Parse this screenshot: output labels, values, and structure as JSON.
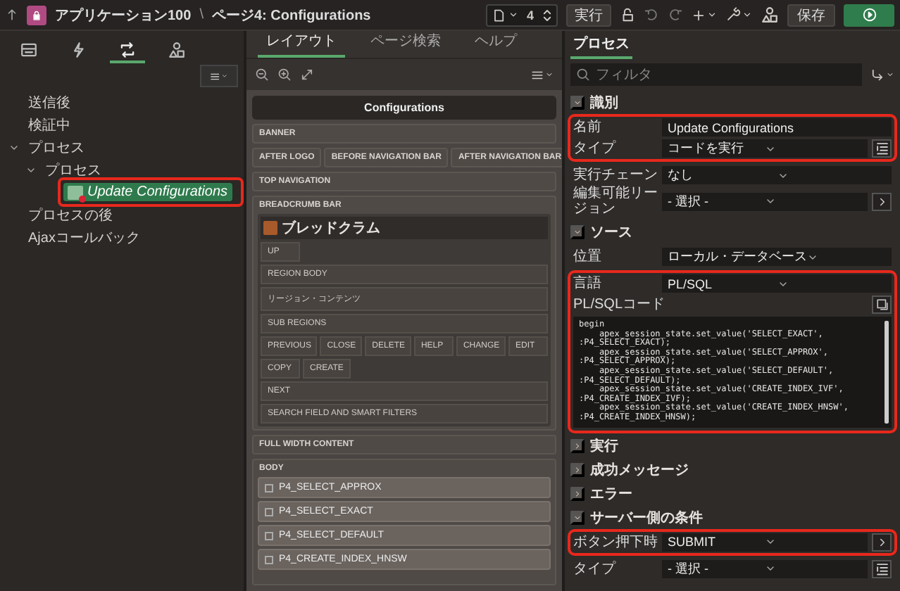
{
  "toolbar": {
    "app": "アプリケーション100",
    "separator": "\\",
    "page": "ページ4: Configurations",
    "page_number": "4",
    "run_page": "実行",
    "save": "保存"
  },
  "left": {
    "tabs": [
      {
        "selected": false
      },
      {
        "selected": false
      },
      {
        "selected": true
      },
      {
        "selected": false
      }
    ],
    "tree": [
      {
        "label": "送信後",
        "kind": "group",
        "selected": false,
        "highlighted": false
      },
      {
        "label": "検証中",
        "kind": "group",
        "selected": false,
        "highlighted": false
      },
      {
        "label": "プロセス",
        "kind": "group",
        "selected": false,
        "highlighted": false,
        "expanded": true,
        "children": [
          {
            "label": "プロセス",
            "kind": "group",
            "selected": false,
            "highlighted": false,
            "expanded": true,
            "children": [
              {
                "label": "Update Configurations",
                "kind": "process",
                "selected": true,
                "highlighted": true
              }
            ]
          }
        ]
      },
      {
        "label": "プロセスの後",
        "kind": "group",
        "selected": false,
        "highlighted": false
      },
      {
        "label": "Ajaxコールバック",
        "kind": "group",
        "selected": false,
        "highlighted": false
      }
    ]
  },
  "middle": {
    "tabs": [
      {
        "label": "レイアウト",
        "selected": true
      },
      {
        "label": "ページ検索",
        "selected": false
      },
      {
        "label": "ヘルプ",
        "selected": false
      }
    ],
    "canvas": {
      "title": "Configurations",
      "positions": [
        {
          "kind": "slot",
          "label": "BANNER"
        },
        {
          "kind": "slot_row",
          "labels": [
            "AFTER LOGO",
            "BEFORE NAVIGATION BAR",
            "AFTER NAVIGATION BAR"
          ]
        },
        {
          "kind": "slot",
          "label": "TOP NAVIGATION"
        },
        {
          "kind": "region_container",
          "label": "BREADCRUMB BAR",
          "region": {
            "title": "ブレッドクラム",
            "slots": [
              {
                "kind": "button_slots",
                "labels": [
                  "UP"
                ]
              },
              {
                "kind": "slot",
                "label": "REGION BODY"
              },
              {
                "kind": "slot",
                "label": "リージョン・コンテンツ"
              },
              {
                "kind": "slot",
                "label": "SUB REGIONS"
              },
              {
                "kind": "button_slots",
                "labels": [
                  "PREVIOUS",
                  "CLOSE",
                  "DELETE",
                  "HELP",
                  "CHANGE",
                  "EDIT"
                ]
              },
              {
                "kind": "button_slots",
                "labels": [
                  "COPY",
                  "CREATE"
                ]
              },
              {
                "kind": "slot",
                "label": "NEXT"
              },
              {
                "kind": "slot",
                "label": "SEARCH FIELD AND SMART FILTERS"
              }
            ]
          }
        },
        {
          "kind": "slot",
          "label": "FULL WIDTH CONTENT"
        },
        {
          "kind": "item_container",
          "label": "BODY",
          "items": [
            "P4_SELECT_APPROX",
            "P4_SELECT_EXACT",
            "P4_SELECT_DEFAULT",
            "P4_CREATE_INDEX_HNSW"
          ]
        }
      ]
    }
  },
  "right": {
    "tab": "プロセス",
    "filter": {
      "placeholder": "フィルタ"
    },
    "sections": [
      {
        "title": "識別",
        "expanded": true,
        "groups": [
          {
            "highlighted": true,
            "rows": [
              {
                "kind": "input",
                "label": "名前",
                "value": "Update Configurations"
              },
              {
                "kind": "select_list",
                "label": "タイプ",
                "value": "コードを実行"
              }
            ]
          },
          {
            "highlighted": false,
            "rows": [
              {
                "kind": "select",
                "label": "実行チェーン",
                "value": "なし"
              },
              {
                "kind": "select_link",
                "label": "編集可能リージョン",
                "value": "- 選択 -"
              }
            ]
          }
        ]
      },
      {
        "title": "ソース",
        "expanded": true,
        "groups": [
          {
            "highlighted": false,
            "rows": [
              {
                "kind": "select",
                "label": "位置",
                "value": "ローカル・データベース"
              }
            ]
          },
          {
            "highlighted": true,
            "rows": [
              {
                "kind": "select",
                "label": "言語",
                "value": "PL/SQL"
              },
              {
                "kind": "code",
                "label": "PL/SQLコード",
                "value": "begin\n    apex_session_state.set_value('SELECT_EXACT',\n:P4_SELECT_EXACT);\n    apex_session_state.set_value('SELECT_APPROX',\n:P4_SELECT_APPROX);\n    apex_session_state.set_value('SELECT_DEFAULT',\n:P4_SELECT_DEFAULT);\n    apex_session_state.set_value('CREATE_INDEX_IVF',\n:P4_CREATE_INDEX_IVF);\n    apex_session_state.set_value('CREATE_INDEX_HNSW',\n:P4_CREATE_INDEX_HNSW);"
              }
            ]
          }
        ]
      },
      {
        "title": "実行",
        "expanded": false
      },
      {
        "title": "成功メッセージ",
        "expanded": false
      },
      {
        "title": "エラー",
        "expanded": false
      },
      {
        "title": "サーバー側の条件",
        "expanded": true,
        "groups": [
          {
            "highlighted": true,
            "rows": [
              {
                "kind": "select_link",
                "label": "ボタン押下時",
                "value": "SUBMIT"
              }
            ]
          },
          {
            "highlighted": false,
            "rows": [
              {
                "kind": "select_list",
                "label": "タイプ",
                "value": "- 選択 -"
              }
            ]
          }
        ]
      }
    ]
  }
}
